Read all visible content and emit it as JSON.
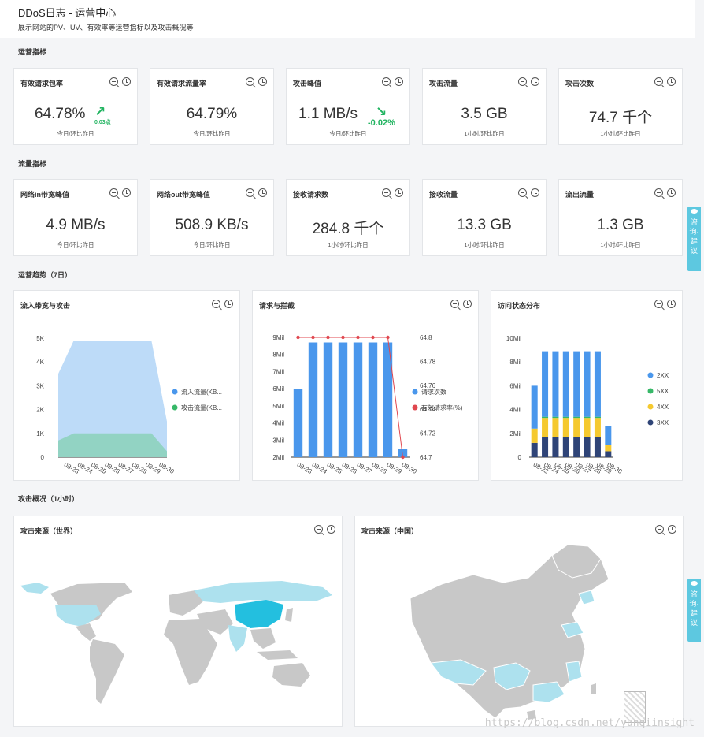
{
  "header": {
    "title": "DDoS日志 - 运营中心",
    "subtitle": "展示网站的PV、UV、有效率等运营指标以及攻击概况等"
  },
  "sections": {
    "ops": "运营指标",
    "traffic": "流量指标",
    "trend": "运营趋势（7日）",
    "attack": "攻击概况（1小时）"
  },
  "ops_cards": [
    {
      "title": "有效请求包率",
      "value": "64.78%",
      "sub": "今日/环比昨日",
      "trend": "0.03点",
      "trend_color": "#22b461"
    },
    {
      "title": "有效请求流量率",
      "value": "64.79%",
      "sub": "今日/环比昨日"
    },
    {
      "title": "攻击峰值",
      "value": "1.1 MB/s",
      "sub": "今日/环比昨日",
      "trend": "-0.02%",
      "trend_color": "#22b461"
    },
    {
      "title": "攻击流量",
      "value": "3.5 GB",
      "sub": "1小时/环比昨日"
    },
    {
      "title": "攻击次数",
      "value": "74.7 千个",
      "sub": "1小时/环比昨日"
    }
  ],
  "traffic_cards": [
    {
      "title": "网络in带宽峰值",
      "value": "4.9 MB/s",
      "sub": "今日/环比昨日"
    },
    {
      "title": "网络out带宽峰值",
      "value": "508.9 KB/s",
      "sub": "今日/环比昨日"
    },
    {
      "title": "接收请求数",
      "value": "284.8 千个",
      "sub": "1小时/环比昨日"
    },
    {
      "title": "接收流量",
      "value": "13.3 GB",
      "sub": "1小时/环比昨日"
    },
    {
      "title": "流出流量",
      "value": "1.3 GB",
      "sub": "1小时/环比昨日"
    }
  ],
  "charts": {
    "bandwidth_title": "流入带宽与攻击",
    "requests_title": "请求与拦截",
    "status_title": "访问状态分布",
    "world_title": "攻击来源（世界）",
    "china_title": "攻击来源（中国）"
  },
  "chart_data": [
    {
      "type": "area",
      "title": "流入带宽与攻击",
      "categories": [
        "08-23",
        "08-24",
        "08-25",
        "08-26",
        "08-27",
        "08-28",
        "08-29",
        "08-30"
      ],
      "series": [
        {
          "name": "流入流量(KB...",
          "values": [
            3500,
            4900,
            4900,
            4900,
            4900,
            4900,
            4900,
            1500
          ],
          "color": "#b6d7f7"
        },
        {
          "name": "攻击流量(KB...",
          "values": [
            700,
            1000,
            1000,
            1000,
            1000,
            1000,
            1000,
            250
          ],
          "color": "#8fd3c0"
        }
      ],
      "yticks": [
        "0",
        "1K",
        "2K",
        "3K",
        "4K",
        "5K"
      ],
      "ylim": [
        0,
        5000
      ],
      "legend": "right"
    },
    {
      "type": "bar",
      "title": "请求与拦截",
      "categories": [
        "08-23",
        "08-24",
        "08-25",
        "08-26",
        "08-27",
        "08-28",
        "08-29",
        "08-30"
      ],
      "series": [
        {
          "name": "请求次数",
          "values": [
            6000000,
            8700000,
            8700000,
            8700000,
            8700000,
            8700000,
            8700000,
            2500000
          ],
          "color": "#4a97ec"
        },
        {
          "name": "有效请求率(%)",
          "values": [
            64.8,
            64.8,
            64.8,
            64.8,
            64.8,
            64.8,
            64.8,
            64.7
          ],
          "color": "#e0474f",
          "axis": "right"
        }
      ],
      "yticks": [
        "2Mil",
        "3Mil",
        "4Mil",
        "5Mil",
        "6Mil",
        "7Mil",
        "8Mil",
        "9Mil"
      ],
      "ylim": [
        2000000,
        9000000
      ],
      "yticks_right": [
        "64.7",
        "64.72",
        "64.74",
        "64.76",
        "64.78",
        "64.8"
      ],
      "ylim_right": [
        64.7,
        64.8
      ],
      "legend": "right"
    },
    {
      "type": "bar",
      "stacked": true,
      "title": "访问状态分布",
      "categories": [
        "08-23",
        "08-24",
        "08-25",
        "08-26",
        "08-27",
        "08-28",
        "08-29",
        "08-30"
      ],
      "series": [
        {
          "name": "3XX",
          "values": [
            1200000,
            1700000,
            1700000,
            1700000,
            1700000,
            1700000,
            1700000,
            500000
          ],
          "color": "#2f4477"
        },
        {
          "name": "4XX",
          "values": [
            1200000,
            1600000,
            1600000,
            1600000,
            1600000,
            1600000,
            1600000,
            500000
          ],
          "color": "#f5c92f"
        },
        {
          "name": "5XX",
          "values": [
            0,
            100000,
            100000,
            100000,
            100000,
            100000,
            100000,
            0
          ],
          "color": "#37b868"
        },
        {
          "name": "2XX",
          "values": [
            3600000,
            5500000,
            5500000,
            5500000,
            5500000,
            5500000,
            5500000,
            1600000
          ],
          "color": "#4a97ec"
        }
      ],
      "yticks": [
        "0",
        "2Mil",
        "4Mil",
        "6Mil",
        "8Mil",
        "10Mil"
      ],
      "ylim": [
        0,
        10000000
      ],
      "legend": "right"
    }
  ],
  "side_tab": {
    "label": "咨询·建议"
  },
  "watermark": "https://blog.csdn.net/yunqiinsight"
}
